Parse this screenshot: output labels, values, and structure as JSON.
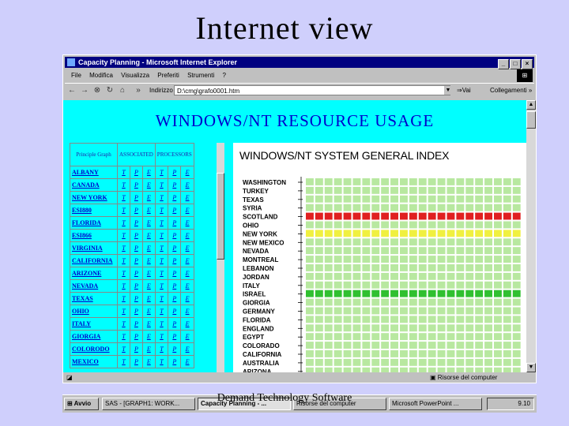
{
  "slide": {
    "title": "Internet view",
    "footer": "Demand Technology Software"
  },
  "window": {
    "title": "Capacity Planning - Microsoft Internet Explorer",
    "menu": [
      "File",
      "Modifica",
      "Visualizza",
      "Preferiti",
      "Strumenti",
      "?"
    ],
    "address_label": "Indirizzo",
    "address_value": "D:\\cmg\\grafo0001.htm",
    "go_label": "Vai",
    "links_label": "Collegamenti",
    "status_zone": "Risorse del computer"
  },
  "page": {
    "header": "WINDOWS/NT RESOURCE USAGE",
    "table_headers": [
      "Principle Graph",
      "ASSOCIATED",
      "PROCESSORS"
    ],
    "servers": [
      {
        "name": "ALBANY",
        "links": [
          "T",
          "P",
          "E",
          "T",
          "P",
          "E"
        ]
      },
      {
        "name": "CANADA",
        "links": [
          "T",
          "P",
          "E",
          "T",
          "P",
          "E"
        ]
      },
      {
        "name": "NEW YORK",
        "links": [
          "T",
          "P",
          "E",
          "T",
          "P",
          "E"
        ]
      },
      {
        "name": "ESI880",
        "links": [
          "T",
          "P",
          "E",
          "T",
          "P",
          "E"
        ]
      },
      {
        "name": "FLORIDA",
        "links": [
          "T",
          "P",
          "E",
          "T",
          "P",
          "E"
        ]
      },
      {
        "name": "ESI866",
        "links": [
          "T",
          "P",
          "E",
          "T",
          "P",
          "E"
        ]
      },
      {
        "name": "VIRGINIA",
        "links": [
          "T",
          "P",
          "E",
          "T",
          "P",
          "E"
        ]
      },
      {
        "name": "CALIFORNIA",
        "links": [
          "T",
          "P",
          "E",
          "T",
          "P",
          "E"
        ]
      },
      {
        "name": "ARIZONE",
        "links": [
          "T",
          "P",
          "E",
          "T",
          "P",
          "E"
        ]
      },
      {
        "name": "NEVADA",
        "links": [
          "T",
          "P",
          "E",
          "T",
          "P",
          "E"
        ]
      },
      {
        "name": "TEXAS",
        "links": [
          "T",
          "P",
          "E",
          "T",
          "P",
          "E"
        ]
      },
      {
        "name": "OHIO",
        "links": [
          "T",
          "P",
          "E",
          "T",
          "P",
          "E"
        ]
      },
      {
        "name": "ITALY",
        "links": [
          "T",
          "P",
          "E",
          "T",
          "P",
          "E"
        ]
      },
      {
        "name": "GIORGIA",
        "links": [
          "T",
          "P",
          "E",
          "T",
          "P",
          "E"
        ]
      },
      {
        "name": "COLORODO",
        "links": [
          "T",
          "P",
          "E",
          "T",
          "P",
          "E"
        ]
      },
      {
        "name": "MEXICO",
        "links": [
          "T",
          "P",
          "E",
          "T",
          "P",
          "E"
        ]
      }
    ]
  },
  "chart_data": {
    "type": "heatmap",
    "title": "WINDOWS/NT SYSTEM GENERAL INDEX",
    "columns": 23,
    "rows": [
      "WASHINGTON",
      "TURKEY",
      "TEXAS",
      "SYRIA",
      "SCOTLAND",
      "OHIO",
      "NEW YORK",
      "NEW MEXICO",
      "NEVADA",
      "MONTREAL",
      "LEBANON",
      "JORDAN",
      "ITALY",
      "ISRAEL",
      "GIORGIA",
      "GERMANY",
      "FLORIDA",
      "ENGLAND",
      "EGYPT",
      "COLORADO",
      "CALIFORNIA",
      "AUSTRALIA",
      "ARIZONA"
    ],
    "row_status": [
      "ok",
      "ok",
      "ok",
      "ok",
      "critical",
      "ok",
      "warning",
      "ok",
      "ok",
      "ok",
      "ok",
      "ok",
      "ok",
      "elevated",
      "ok",
      "ok",
      "ok",
      "ok",
      "ok",
      "ok",
      "ok",
      "ok",
      "ok"
    ],
    "status_colors": {
      "ok": "#b8e8a0",
      "critical": "#e02020",
      "warning": "#f0f040",
      "elevated": "#30c030"
    }
  },
  "taskbar": {
    "start": "Avvio",
    "tasks": [
      "SAS - [GRAPH1: WORK...",
      "Capacity Planning - ...",
      "Risorse del computer",
      "Microsoft PowerPoint ..."
    ],
    "clock": "9.10"
  }
}
